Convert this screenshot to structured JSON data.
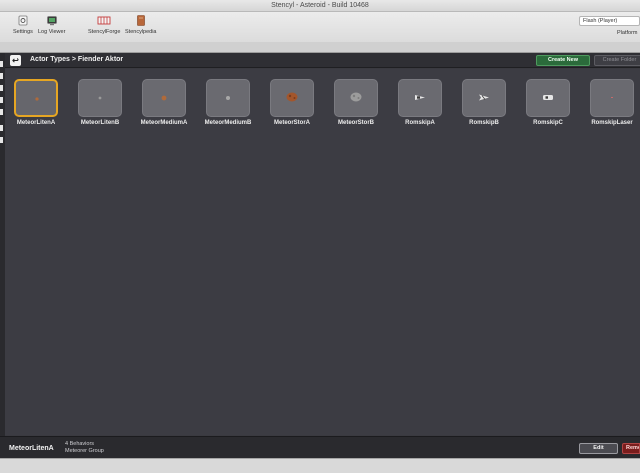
{
  "window": {
    "title": "Stencyl - Asteroid - Build 10468"
  },
  "toolbar": {
    "items": [
      {
        "label": "Settings",
        "icon": "settings-icon"
      },
      {
        "label": "Log Viewer",
        "icon": "log-viewer-icon"
      },
      {
        "label": "StencylForge",
        "icon": "stencylforge-icon"
      },
      {
        "label": "Stencylpedia",
        "icon": "stencylpedia-icon"
      }
    ],
    "platform_value": "Flash (Player)",
    "platform_label": "Platform"
  },
  "header": {
    "breadcrumb": "Actor Types > Fiender Aktor",
    "create_new_label": "Create New",
    "create_folder_label": "Create Folder"
  },
  "actors": [
    {
      "name": "MeteorLitenA",
      "icon": "small-meteor-icon",
      "color": "#b06a3a"
    },
    {
      "name": "MeteorLitenB",
      "icon": "small-meteor-icon",
      "color": "#9a9a9a"
    },
    {
      "name": "MeteorMediumA",
      "icon": "medium-meteor-icon",
      "color": "#b06a3a"
    },
    {
      "name": "MeteorMediumB",
      "icon": "medium-meteor-icon",
      "color": "#a8a8a8"
    },
    {
      "name": "MeteorStorA",
      "icon": "large-meteor-icon",
      "color": "#b06a3a"
    },
    {
      "name": "MeteorStorB",
      "icon": "large-meteor-icon",
      "color": "#a8a8a8"
    },
    {
      "name": "RomskipA",
      "icon": "spaceship-icon",
      "color": "#e0e0e0"
    },
    {
      "name": "RomskipB",
      "icon": "spaceship-icon",
      "color": "#e0e0e0"
    },
    {
      "name": "RomskipC",
      "icon": "spaceship-icon",
      "color": "#e0e0e0"
    },
    {
      "name": "RomskipLaser",
      "icon": "laser-icon",
      "color": "#c56a6a"
    }
  ],
  "selected": {
    "name": "MeteorLitenA",
    "behaviors": "4 Behaviors",
    "group": "Meteorer Group",
    "edit_label": "Edit",
    "remove_label": "Remove"
  },
  "colors": {
    "accent_green": "#2b6b3b",
    "selection": "#e6a623",
    "danger": "#7a1d1d"
  }
}
